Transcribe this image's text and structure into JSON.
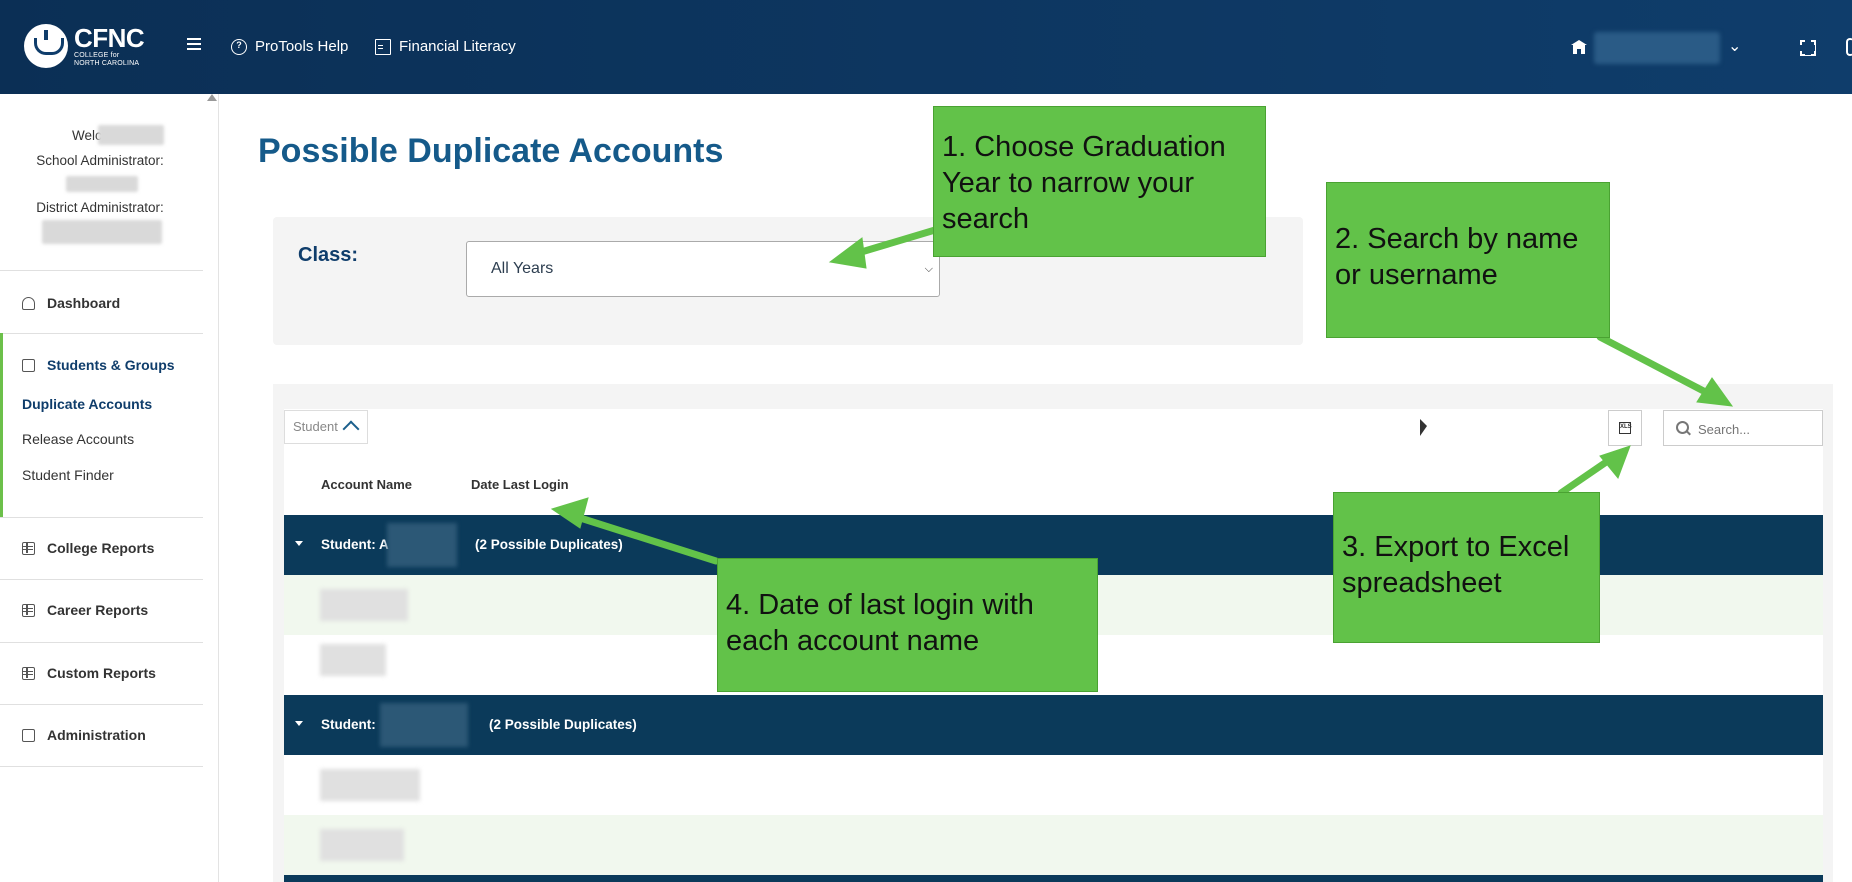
{
  "header": {
    "logo": {
      "title": "CFNC",
      "subtitle_line1": "COLLEGE for",
      "subtitle_line2": "NORTH CAROLINA"
    },
    "nav": [
      {
        "label": "ProTools Help",
        "icon": "help-circle-icon"
      },
      {
        "label": "Financial Literacy",
        "icon": "document-icon"
      }
    ],
    "background": "#0f3d6b"
  },
  "sidebar": {
    "welcome_label": "Welcome",
    "school_admin_label": "School Administrator:",
    "district_admin_label": "District Administrator:",
    "items": [
      {
        "label": "Dashboard",
        "icon": "dashboard-icon"
      },
      {
        "label": "Students & Groups",
        "icon": "student-icon"
      },
      {
        "label": "College Reports",
        "icon": "table-icon"
      },
      {
        "label": "Career Reports",
        "icon": "table-icon"
      },
      {
        "label": "Custom Reports",
        "icon": "table-icon"
      },
      {
        "label": "Administration",
        "icon": "edit-icon"
      }
    ],
    "subitems": [
      {
        "label": "Duplicate Accounts",
        "active": true
      },
      {
        "label": "Release Accounts",
        "active": false
      },
      {
        "label": "Student Finder",
        "active": false
      }
    ],
    "accent": "#6cc04a"
  },
  "main": {
    "title": "Possible Duplicate Accounts",
    "class_label": "Class:",
    "class_select_value": "All Years",
    "grid": {
      "group_chip": "Student",
      "search_placeholder": "Search...",
      "columns": [
        "Account Name",
        "Date Last Login"
      ],
      "groups": [
        {
          "label": "Student: A",
          "suffix": "(2 Possible Duplicates)"
        },
        {
          "label": "Student:",
          "suffix": "(2 Possible Duplicates)"
        }
      ],
      "group_row_color": "#0b3a5a",
      "alt_row_color": "#f1f8ee"
    }
  },
  "callouts": [
    "1. Choose Graduation Year to narrow your search",
    "2. Search by name or username",
    "3. Export to Excel spreadsheet",
    "4. Date of last login with each account name"
  ],
  "callout_color": "#62c249"
}
